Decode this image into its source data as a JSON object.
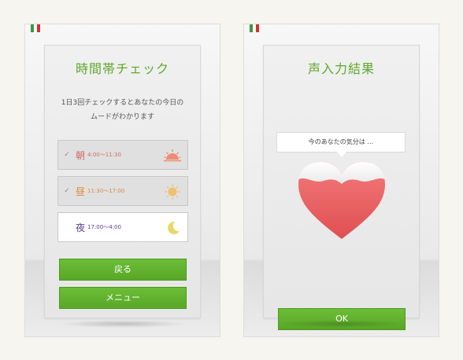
{
  "left_screen": {
    "title": "時間帯チェック",
    "description_line1": "1日3回チェックするとあなたの今日の",
    "description_line2": "ムードがわかります",
    "slots": [
      {
        "name": "朝",
        "time": "4:00〜11:30",
        "checked": true,
        "icon": "sunrise-icon",
        "color": "#cc6b63"
      },
      {
        "name": "昼",
        "time": "11:30〜17:00",
        "checked": true,
        "icon": "sun-icon",
        "color": "#d98a3a"
      },
      {
        "name": "夜",
        "time": "17:00〜4:00",
        "checked": false,
        "icon": "moon-icon",
        "color": "#5a3b8a"
      }
    ],
    "check_mark": "✓",
    "back_button": "戻る",
    "menu_button": "メニュー"
  },
  "right_screen": {
    "title": "声入力結果",
    "bubble_text": "今のあなたの気分は …",
    "ok_button": "OK"
  },
  "colors": {
    "accent_green": "#5fa82a",
    "heart_red": "#ee5a5c"
  }
}
